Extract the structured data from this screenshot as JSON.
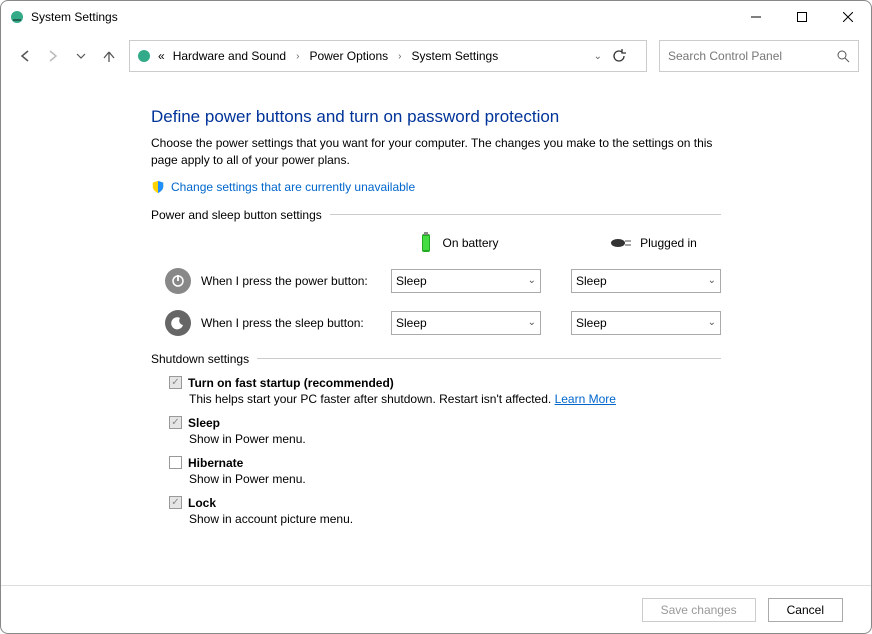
{
  "window": {
    "title": "System Settings"
  },
  "breadcrumb": {
    "prefix_chevrons": "«",
    "items": [
      "Hardware and Sound",
      "Power Options",
      "System Settings"
    ]
  },
  "search": {
    "placeholder": "Search Control Panel"
  },
  "page": {
    "title": "Define power buttons and turn on password protection",
    "description": "Choose the power settings that you want for your computer. The changes you make to the settings on this page apply to all of your power plans.",
    "admin_link": "Change settings that are currently unavailable"
  },
  "sections": {
    "button_settings": {
      "label": "Power and sleep button settings",
      "columns": {
        "battery": "On battery",
        "plugged": "Plugged in"
      },
      "rows": {
        "power": {
          "label": "When I press the power button:",
          "battery_value": "Sleep",
          "plugged_value": "Sleep"
        },
        "sleep": {
          "label": "When I press the sleep button:",
          "battery_value": "Sleep",
          "plugged_value": "Sleep"
        }
      }
    },
    "shutdown": {
      "label": "Shutdown settings",
      "items": {
        "fast_startup": {
          "title": "Turn on fast startup (recommended)",
          "sub": "This helps start your PC faster after shutdown. Restart isn't affected. ",
          "learn_more": "Learn More",
          "checked": true,
          "disabled": true
        },
        "sleep": {
          "title": "Sleep",
          "sub": "Show in Power menu.",
          "checked": true,
          "disabled": true
        },
        "hibernate": {
          "title": "Hibernate",
          "sub": "Show in Power menu.",
          "checked": false,
          "disabled": true
        },
        "lock": {
          "title": "Lock",
          "sub": "Show in account picture menu.",
          "checked": true,
          "disabled": true
        }
      }
    }
  },
  "footer": {
    "save": "Save changes",
    "cancel": "Cancel"
  }
}
